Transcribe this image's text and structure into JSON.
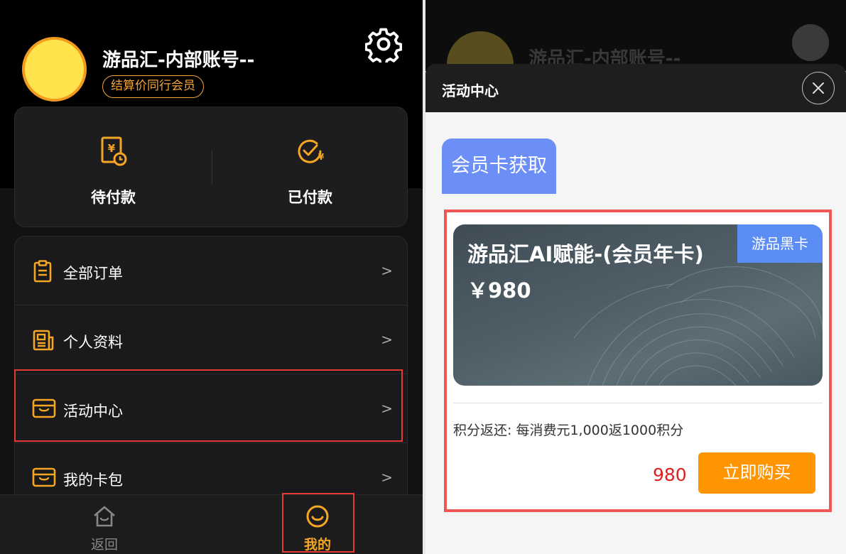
{
  "left": {
    "user": {
      "name": "游品汇-内部账号--",
      "badge": "结算价同行会员"
    },
    "pay": {
      "pending_label": "待付款",
      "paid_label": "已付款"
    },
    "menu": [
      {
        "label": "全部订单",
        "icon": "clipboard-icon",
        "arrow": ">"
      },
      {
        "label": "个人资料",
        "icon": "profile-doc-icon",
        "arrow": ">"
      },
      {
        "label": "活动中心",
        "icon": "wallet-icon",
        "arrow": ">"
      },
      {
        "label": "我的卡包",
        "icon": "card-wallet-icon",
        "arrow": ">"
      }
    ],
    "tabs": {
      "back_label": "返回",
      "mine_label": "我的"
    }
  },
  "right": {
    "dim_name": "游品汇-内部账号--",
    "sheet_title": "活动中心",
    "category_tab": "会员卡获取",
    "offer": {
      "card_name": "游品汇AI赋能-(会员年卡)",
      "card_price": "￥980",
      "card_tag": "游品黑卡",
      "points_text": "积分返还: 每消费元1,000返1000积分",
      "price": "980",
      "buy_label": "立即购买"
    }
  },
  "colors": {
    "accent": "#f5a623",
    "highlight": "#e53935",
    "tab_blue": "#6c8ff7",
    "buy": "#ff9500"
  }
}
